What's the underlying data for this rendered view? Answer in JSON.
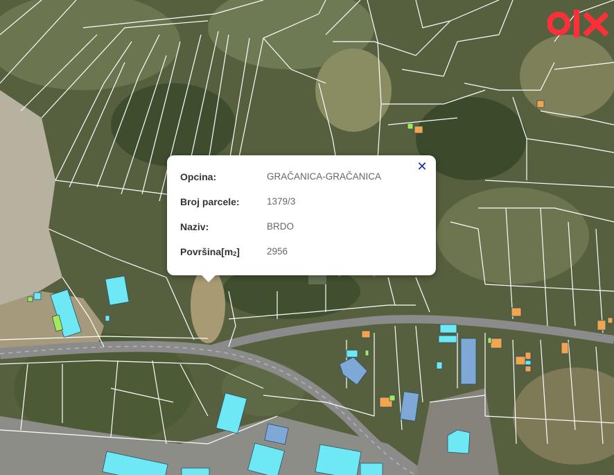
{
  "colors": {
    "vegetation": "#4f5a3a",
    "parcel_line": "#ffffff",
    "road": "#7d7f80",
    "building_cyan": "#6fe8f5",
    "building_blue": "#7ea8d6",
    "building_orange": "#f5a44e",
    "building_green": "#a7e85a",
    "logo_red": "#ff2f3a",
    "close_icon": "#1d2aa8"
  },
  "popup": {
    "rows": [
      {
        "key": "Opcina:",
        "value": "GRAČANICA-GRAČANICA"
      },
      {
        "key": "Broj parcele:",
        "value": "1379/3"
      },
      {
        "key": "Naziv:",
        "value": "BRDO"
      },
      {
        "key": "Površina[m",
        "key_sub": "2",
        "key_end": "]",
        "value": "2956"
      }
    ]
  },
  "icons": {
    "close": "close-icon",
    "brand_logo": "olx-logo"
  }
}
